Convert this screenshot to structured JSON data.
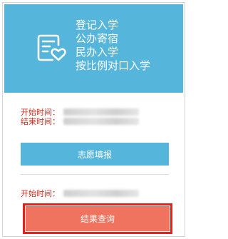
{
  "hero": {
    "icon": "form-heart-icon",
    "lines": [
      "登记入学",
      "公办寄宿",
      "民办入学",
      "按比例对口入学"
    ]
  },
  "schedule": {
    "start_label": "开始时间：",
    "end_label": "结束时间："
  },
  "actions": {
    "apply_label": "志愿填报",
    "result_start_label": "开始时间：",
    "result_label": "结果查询"
  },
  "colors": {
    "hero_bg": "#56b5db",
    "apply_button": "#56b5db",
    "result_button": "#f0735f",
    "label_red": "#d02a1e",
    "highlight_border": "#e8201a"
  }
}
